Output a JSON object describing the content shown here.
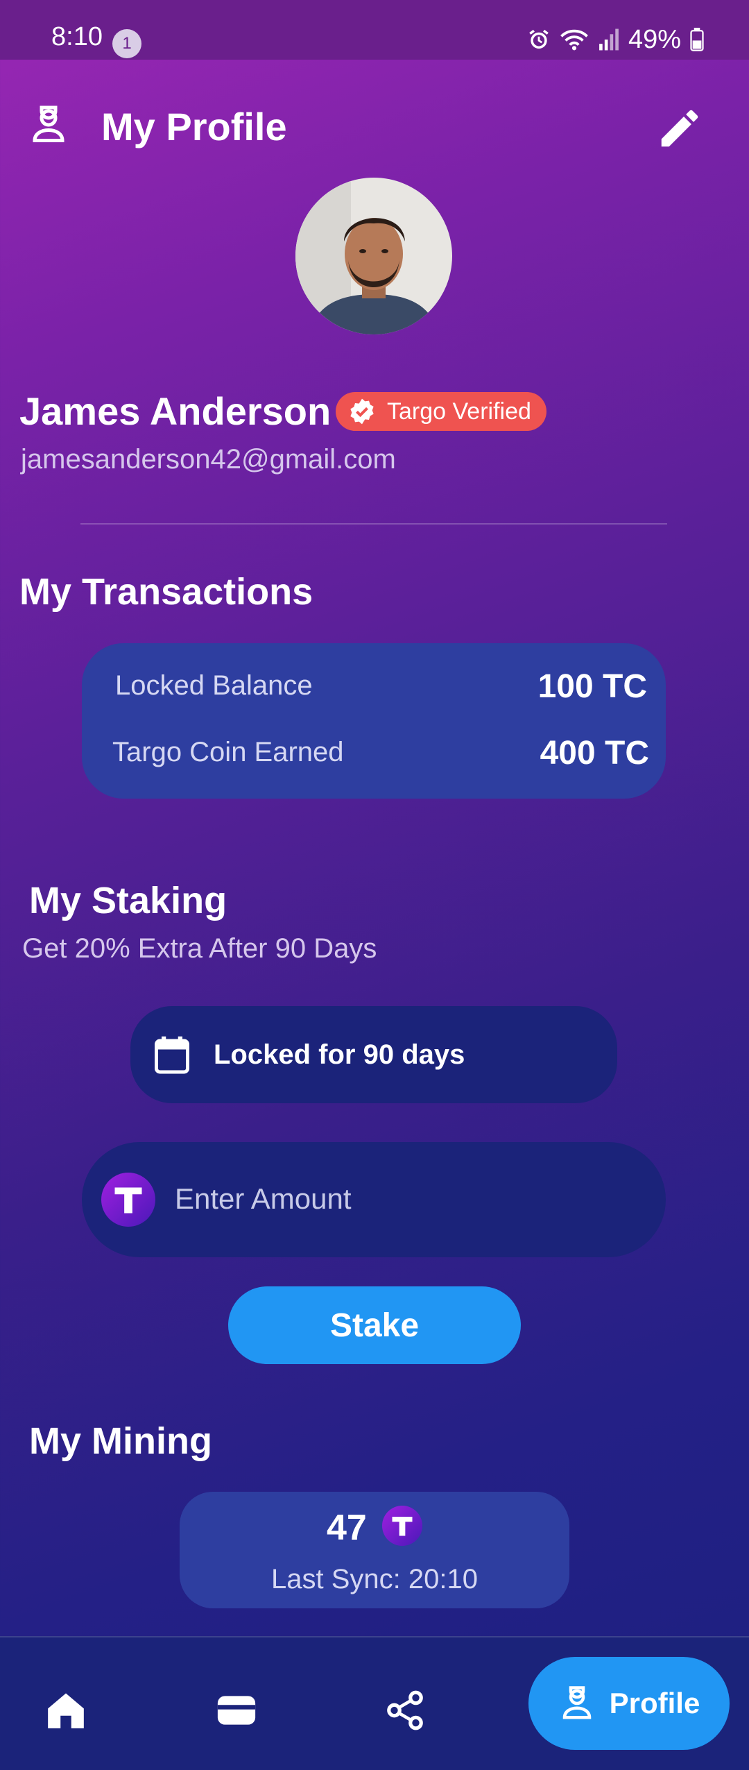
{
  "status_bar": {
    "time": "8:10",
    "notification_count": "1",
    "battery": "49%"
  },
  "header": {
    "title": "My Profile"
  },
  "user": {
    "name": "James Anderson",
    "verified_label": "Targo Verified",
    "email": "jamesanderson42@gmail.com"
  },
  "transactions": {
    "title": "My Transactions",
    "rows": [
      {
        "label": "Locked Balance",
        "value": "100 TC"
      },
      {
        "label": "Targo Coin Earned",
        "value": "400 TC"
      }
    ]
  },
  "staking": {
    "title": "My Staking",
    "subtitle": "Get 20% Extra After 90 Days",
    "lock_label": "Locked for 90 days",
    "amount_placeholder": "Enter Amount",
    "stake_button": "Stake"
  },
  "mining": {
    "title": "My Mining",
    "count": "47",
    "last_sync": "Last Sync: 20:10"
  },
  "bottom_nav": {
    "items": [
      {
        "icon": "home-icon"
      },
      {
        "icon": "wallet-icon"
      },
      {
        "icon": "share-icon"
      },
      {
        "icon": "profile-icon",
        "label": "Profile",
        "active": true
      }
    ]
  },
  "colors": {
    "accent_blue": "#2196f3",
    "card": "#2e3ea0",
    "dark_pill": "#1b237a",
    "verified_red": "#ef5350",
    "coin_purple": "#7b1fd2"
  },
  "icons": {
    "header_left": "profile-icon",
    "header_right": "edit-pencil-icon",
    "calendar": "calendar-icon",
    "coin": "targo-coin-icon"
  }
}
